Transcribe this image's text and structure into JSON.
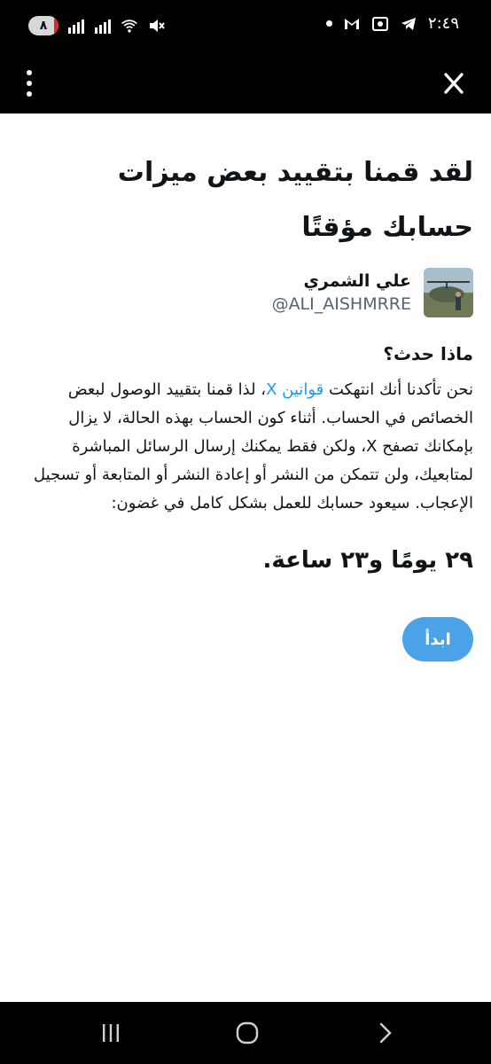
{
  "status_bar": {
    "time": "٢:٤٩",
    "notification_count": "٨"
  },
  "app_bar": {
    "close_label": "X"
  },
  "notice": {
    "title": "لقد قمنا بتقييد بعض ميزات حسابك مؤقتًا",
    "profile": {
      "name": "علي الشمري",
      "handle": "@ALI_AISHMRRE"
    },
    "section_title": "ماذا حدث؟",
    "body_before_link": "نحن تأكدنا أنك انتهكت ",
    "body_link": "قوانين X",
    "body_after_link": "، لذا قمنا بتقييد الوصول لبعض الخصائص في الحساب. أثناء كون الحساب بهذه الحالة، لا يزال بإمكانك تصفح X، ولكن فقط يمكنك إرسال الرسائل المباشرة لمتابعيك، ولن تتمكن من النشر أو إعادة النشر أو المتابعة أو تسجيل الإعجاب. سيعود حسابك للعمل بشكل كامل في غضون:",
    "countdown": "٢٩ يومًا و٢٣ ساعة.",
    "start_button": "ابدأ"
  },
  "colors": {
    "link": "#1d9bf0",
    "button": "#4aa3e6",
    "text": "#0f1419",
    "muted": "#536471"
  },
  "icons": [
    "notification-badge",
    "signal-icon",
    "wifi-icon",
    "mute-icon",
    "dot-icon",
    "gmail-icon",
    "screenshot-icon",
    "telegram-icon",
    "menu-dots-icon",
    "close-icon",
    "recents-icon",
    "home-icon",
    "back-icon"
  ]
}
